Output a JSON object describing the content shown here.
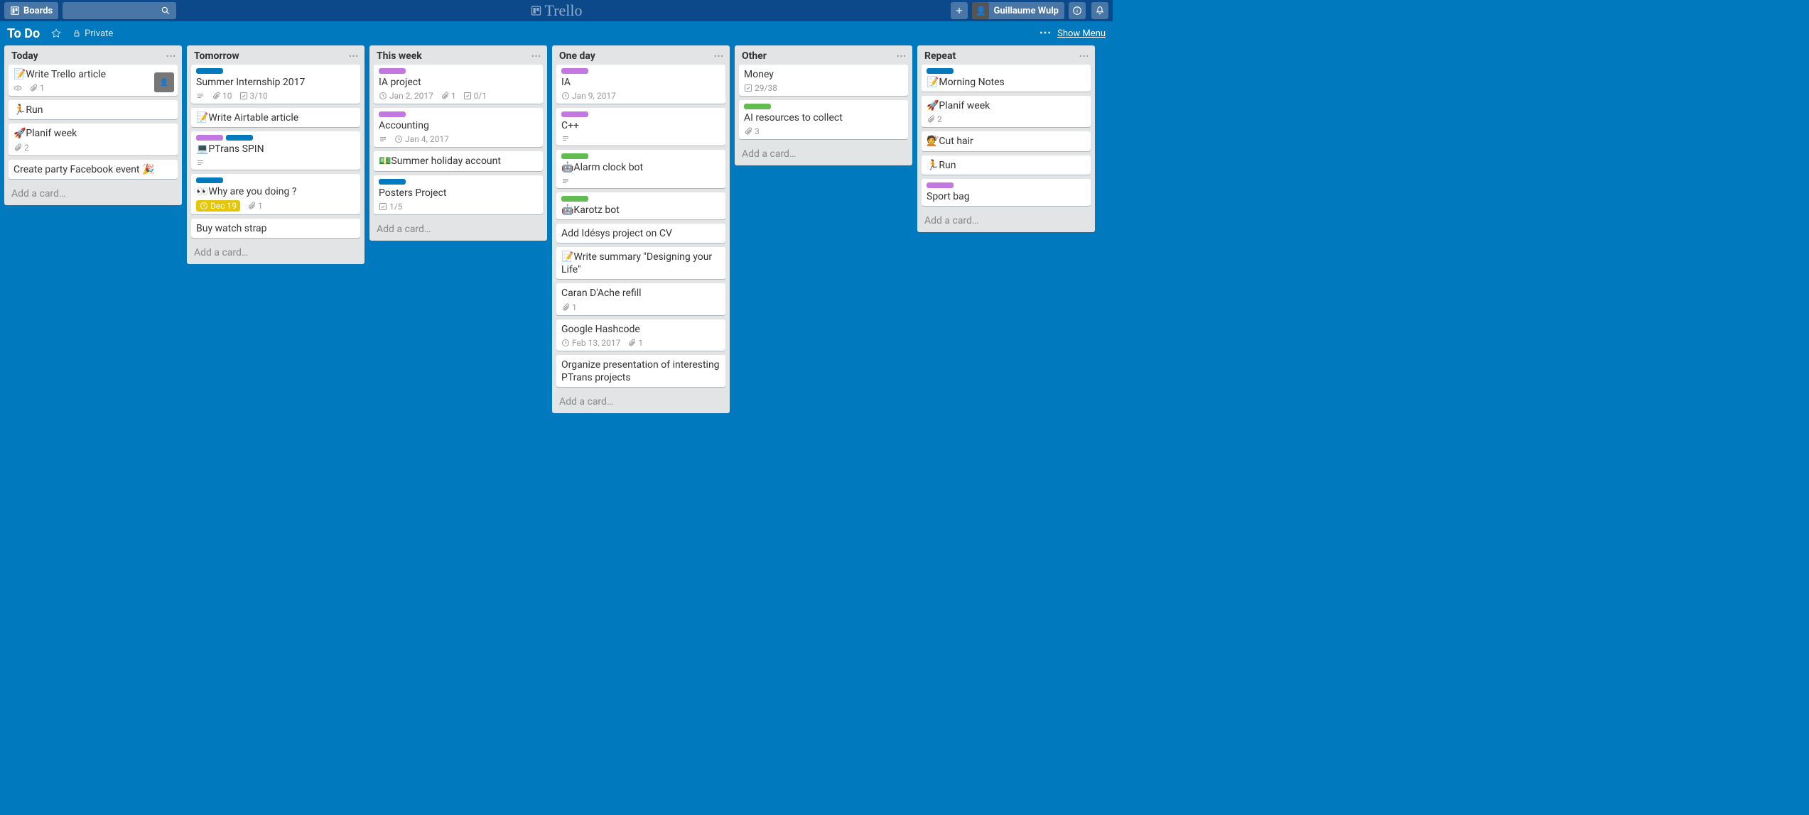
{
  "header": {
    "boards_label": "Boards",
    "app_name": "Trello",
    "user_name": "Guillaume Wulp"
  },
  "board": {
    "title": "To Do",
    "privacy": "Private",
    "show_menu": "Show Menu"
  },
  "add_card_label": "Add a card…",
  "lists": [
    {
      "title": "Today",
      "cards": [
        {
          "title": "📝Write Trello article",
          "badges": {
            "eye": true,
            "attach": 1,
            "member": true
          }
        },
        {
          "title": "🏃Run"
        },
        {
          "title": "🚀Planif week",
          "badges": {
            "attach": 2
          }
        },
        {
          "title": "Create party Facebook event 🎉"
        }
      ]
    },
    {
      "title": "Tomorrow",
      "cards": [
        {
          "labels": [
            "blue"
          ],
          "title": "Summer Internship 2017",
          "badges": {
            "desc": true,
            "attach": 10,
            "check": "3/10"
          }
        },
        {
          "title": "📝Write Airtable article"
        },
        {
          "labels": [
            "purple",
            "blue"
          ],
          "title": "💻PTrans SPIN",
          "badges": {
            "desc": true
          }
        },
        {
          "labels": [
            "blue"
          ],
          "title": "👀Why are you doing ?",
          "badges": {
            "due": "Dec 19",
            "attach": 1
          }
        },
        {
          "title": "Buy watch strap"
        }
      ]
    },
    {
      "title": "This week",
      "cards": [
        {
          "labels": [
            "purple"
          ],
          "title": "IA project",
          "badges": {
            "date": "Jan 2, 2017",
            "attach": 1,
            "check": "0/1"
          }
        },
        {
          "labels": [
            "purple"
          ],
          "title": "Accounting",
          "badges": {
            "date": "Jan 4, 2017",
            "desc": true
          }
        },
        {
          "title": "💵Summer holiday account"
        },
        {
          "labels": [
            "blue"
          ],
          "title": "Posters Project",
          "badges": {
            "check": "1/5"
          }
        }
      ]
    },
    {
      "title": "One day",
      "cards": [
        {
          "labels": [
            "purple"
          ],
          "title": "IA",
          "badges": {
            "date": "Jan 9, 2017"
          }
        },
        {
          "labels": [
            "purple"
          ],
          "title": "C++",
          "badges": {
            "desc": true
          }
        },
        {
          "labels": [
            "green"
          ],
          "title": "🤖Alarm clock bot",
          "badges": {
            "desc": true
          }
        },
        {
          "labels": [
            "green"
          ],
          "title": "🤖Karotz bot"
        },
        {
          "title": "Add Idésys project on CV"
        },
        {
          "title": "📝Write summary \"Designing your Life\""
        },
        {
          "title": "Caran D'Ache refill",
          "badges": {
            "attach": 1
          }
        },
        {
          "title": "Google Hashcode",
          "badges": {
            "date": "Feb 13, 2017",
            "attach": 1
          }
        },
        {
          "title": "Organize presentation of interesting PTrans projects"
        }
      ]
    },
    {
      "title": "Other",
      "cards": [
        {
          "title": "Money",
          "badges": {
            "check": "29/38"
          }
        },
        {
          "labels": [
            "green"
          ],
          "title": "AI resources to collect",
          "badges": {
            "attach": 3
          }
        }
      ]
    },
    {
      "title": "Repeat",
      "cards": [
        {
          "labels": [
            "blue"
          ],
          "title": "📝Morning Notes"
        },
        {
          "title": "🚀Planif week",
          "badges": {
            "attach": 2
          }
        },
        {
          "title": "💇Cut hair"
        },
        {
          "title": "🏃Run"
        },
        {
          "labels": [
            "purple"
          ],
          "title": "Sport bag"
        }
      ]
    }
  ]
}
